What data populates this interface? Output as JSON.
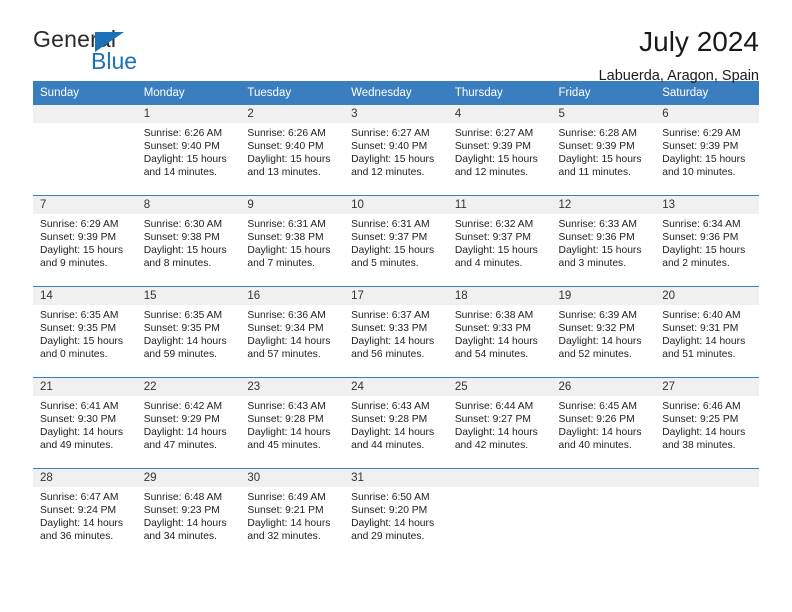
{
  "brand": {
    "name_dark": "General",
    "name_blue": "Blue",
    "accent_color": "#1c71b8"
  },
  "header": {
    "title": "July 2024",
    "location": "Labuerda, Aragon, Spain"
  },
  "theme": {
    "header_bg": "#3b7ebf",
    "daynum_bg": "#f0f0f0",
    "text": "#1f1f1f"
  },
  "calendar": {
    "weekday_headers": [
      "Sunday",
      "Monday",
      "Tuesday",
      "Wednesday",
      "Thursday",
      "Friday",
      "Saturday"
    ],
    "weeks": [
      [
        {
          "day": "",
          "empty": true,
          "sunrise": "",
          "sunset": "",
          "daylight_line1": "",
          "daylight_line2": ""
        },
        {
          "day": "1",
          "sunrise": "Sunrise: 6:26 AM",
          "sunset": "Sunset: 9:40 PM",
          "daylight_line1": "Daylight: 15 hours",
          "daylight_line2": "and 14 minutes."
        },
        {
          "day": "2",
          "sunrise": "Sunrise: 6:26 AM",
          "sunset": "Sunset: 9:40 PM",
          "daylight_line1": "Daylight: 15 hours",
          "daylight_line2": "and 13 minutes."
        },
        {
          "day": "3",
          "sunrise": "Sunrise: 6:27 AM",
          "sunset": "Sunset: 9:40 PM",
          "daylight_line1": "Daylight: 15 hours",
          "daylight_line2": "and 12 minutes."
        },
        {
          "day": "4",
          "sunrise": "Sunrise: 6:27 AM",
          "sunset": "Sunset: 9:39 PM",
          "daylight_line1": "Daylight: 15 hours",
          "daylight_line2": "and 12 minutes."
        },
        {
          "day": "5",
          "sunrise": "Sunrise: 6:28 AM",
          "sunset": "Sunset: 9:39 PM",
          "daylight_line1": "Daylight: 15 hours",
          "daylight_line2": "and 11 minutes."
        },
        {
          "day": "6",
          "sunrise": "Sunrise: 6:29 AM",
          "sunset": "Sunset: 9:39 PM",
          "daylight_line1": "Daylight: 15 hours",
          "daylight_line2": "and 10 minutes."
        }
      ],
      [
        {
          "day": "7",
          "sunrise": "Sunrise: 6:29 AM",
          "sunset": "Sunset: 9:39 PM",
          "daylight_line1": "Daylight: 15 hours",
          "daylight_line2": "and 9 minutes."
        },
        {
          "day": "8",
          "sunrise": "Sunrise: 6:30 AM",
          "sunset": "Sunset: 9:38 PM",
          "daylight_line1": "Daylight: 15 hours",
          "daylight_line2": "and 8 minutes."
        },
        {
          "day": "9",
          "sunrise": "Sunrise: 6:31 AM",
          "sunset": "Sunset: 9:38 PM",
          "daylight_line1": "Daylight: 15 hours",
          "daylight_line2": "and 7 minutes."
        },
        {
          "day": "10",
          "sunrise": "Sunrise: 6:31 AM",
          "sunset": "Sunset: 9:37 PM",
          "daylight_line1": "Daylight: 15 hours",
          "daylight_line2": "and 5 minutes."
        },
        {
          "day": "11",
          "sunrise": "Sunrise: 6:32 AM",
          "sunset": "Sunset: 9:37 PM",
          "daylight_line1": "Daylight: 15 hours",
          "daylight_line2": "and 4 minutes."
        },
        {
          "day": "12",
          "sunrise": "Sunrise: 6:33 AM",
          "sunset": "Sunset: 9:36 PM",
          "daylight_line1": "Daylight: 15 hours",
          "daylight_line2": "and 3 minutes."
        },
        {
          "day": "13",
          "sunrise": "Sunrise: 6:34 AM",
          "sunset": "Sunset: 9:36 PM",
          "daylight_line1": "Daylight: 15 hours",
          "daylight_line2": "and 2 minutes."
        }
      ],
      [
        {
          "day": "14",
          "sunrise": "Sunrise: 6:35 AM",
          "sunset": "Sunset: 9:35 PM",
          "daylight_line1": "Daylight: 15 hours",
          "daylight_line2": "and 0 minutes."
        },
        {
          "day": "15",
          "sunrise": "Sunrise: 6:35 AM",
          "sunset": "Sunset: 9:35 PM",
          "daylight_line1": "Daylight: 14 hours",
          "daylight_line2": "and 59 minutes."
        },
        {
          "day": "16",
          "sunrise": "Sunrise: 6:36 AM",
          "sunset": "Sunset: 9:34 PM",
          "daylight_line1": "Daylight: 14 hours",
          "daylight_line2": "and 57 minutes."
        },
        {
          "day": "17",
          "sunrise": "Sunrise: 6:37 AM",
          "sunset": "Sunset: 9:33 PM",
          "daylight_line1": "Daylight: 14 hours",
          "daylight_line2": "and 56 minutes."
        },
        {
          "day": "18",
          "sunrise": "Sunrise: 6:38 AM",
          "sunset": "Sunset: 9:33 PM",
          "daylight_line1": "Daylight: 14 hours",
          "daylight_line2": "and 54 minutes."
        },
        {
          "day": "19",
          "sunrise": "Sunrise: 6:39 AM",
          "sunset": "Sunset: 9:32 PM",
          "daylight_line1": "Daylight: 14 hours",
          "daylight_line2": "and 52 minutes."
        },
        {
          "day": "20",
          "sunrise": "Sunrise: 6:40 AM",
          "sunset": "Sunset: 9:31 PM",
          "daylight_line1": "Daylight: 14 hours",
          "daylight_line2": "and 51 minutes."
        }
      ],
      [
        {
          "day": "21",
          "sunrise": "Sunrise: 6:41 AM",
          "sunset": "Sunset: 9:30 PM",
          "daylight_line1": "Daylight: 14 hours",
          "daylight_line2": "and 49 minutes."
        },
        {
          "day": "22",
          "sunrise": "Sunrise: 6:42 AM",
          "sunset": "Sunset: 9:29 PM",
          "daylight_line1": "Daylight: 14 hours",
          "daylight_line2": "and 47 minutes."
        },
        {
          "day": "23",
          "sunrise": "Sunrise: 6:43 AM",
          "sunset": "Sunset: 9:28 PM",
          "daylight_line1": "Daylight: 14 hours",
          "daylight_line2": "and 45 minutes."
        },
        {
          "day": "24",
          "sunrise": "Sunrise: 6:43 AM",
          "sunset": "Sunset: 9:28 PM",
          "daylight_line1": "Daylight: 14 hours",
          "daylight_line2": "and 44 minutes."
        },
        {
          "day": "25",
          "sunrise": "Sunrise: 6:44 AM",
          "sunset": "Sunset: 9:27 PM",
          "daylight_line1": "Daylight: 14 hours",
          "daylight_line2": "and 42 minutes."
        },
        {
          "day": "26",
          "sunrise": "Sunrise: 6:45 AM",
          "sunset": "Sunset: 9:26 PM",
          "daylight_line1": "Daylight: 14 hours",
          "daylight_line2": "and 40 minutes."
        },
        {
          "day": "27",
          "sunrise": "Sunrise: 6:46 AM",
          "sunset": "Sunset: 9:25 PM",
          "daylight_line1": "Daylight: 14 hours",
          "daylight_line2": "and 38 minutes."
        }
      ],
      [
        {
          "day": "28",
          "sunrise": "Sunrise: 6:47 AM",
          "sunset": "Sunset: 9:24 PM",
          "daylight_line1": "Daylight: 14 hours",
          "daylight_line2": "and 36 minutes."
        },
        {
          "day": "29",
          "sunrise": "Sunrise: 6:48 AM",
          "sunset": "Sunset: 9:23 PM",
          "daylight_line1": "Daylight: 14 hours",
          "daylight_line2": "and 34 minutes."
        },
        {
          "day": "30",
          "sunrise": "Sunrise: 6:49 AM",
          "sunset": "Sunset: 9:21 PM",
          "daylight_line1": "Daylight: 14 hours",
          "daylight_line2": "and 32 minutes."
        },
        {
          "day": "31",
          "sunrise": "Sunrise: 6:50 AM",
          "sunset": "Sunset: 9:20 PM",
          "daylight_line1": "Daylight: 14 hours",
          "daylight_line2": "and 29 minutes."
        },
        {
          "day": "",
          "empty": true,
          "sunrise": "",
          "sunset": "",
          "daylight_line1": "",
          "daylight_line2": ""
        },
        {
          "day": "",
          "empty": true,
          "sunrise": "",
          "sunset": "",
          "daylight_line1": "",
          "daylight_line2": ""
        },
        {
          "day": "",
          "empty": true,
          "sunrise": "",
          "sunset": "",
          "daylight_line1": "",
          "daylight_line2": ""
        }
      ]
    ]
  }
}
